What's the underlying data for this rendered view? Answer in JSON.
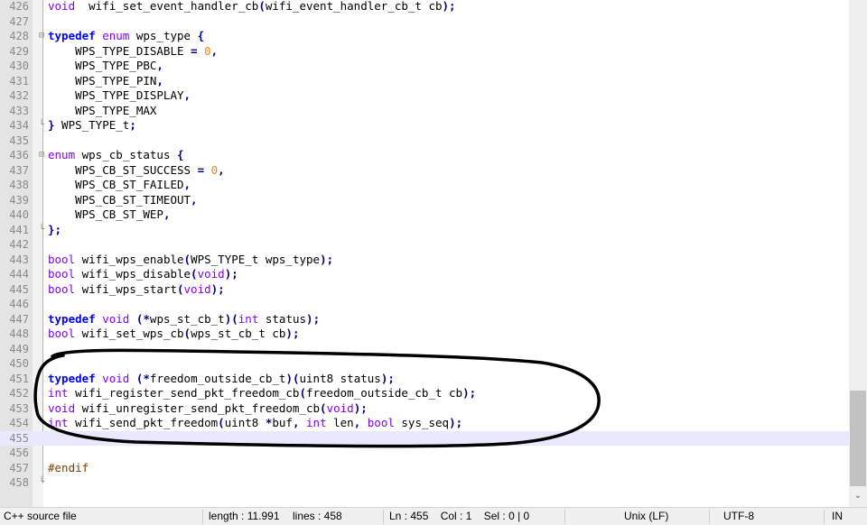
{
  "editor": {
    "current_line": "455",
    "lines": [
      {
        "n": "426",
        "tokens": [
          [
            "ty",
            "void"
          ],
          [
            "",
            "  wifi_set_event_handler_cb"
          ],
          [
            "op",
            "("
          ],
          [
            "",
            "wifi_event_handler_cb_t cb"
          ],
          [
            "op",
            ");"
          ]
        ]
      },
      {
        "n": "427",
        "tokens": []
      },
      {
        "n": "428",
        "fold": "⊟",
        "tokens": [
          [
            "kw",
            "typedef"
          ],
          [
            "",
            " "
          ],
          [
            "ty",
            "enum"
          ],
          [
            "",
            " wps_type "
          ],
          [
            "op",
            "{"
          ]
        ]
      },
      {
        "n": "429",
        "tokens": [
          [
            "",
            "    WPS_TYPE_DISABLE "
          ],
          [
            "op",
            "="
          ],
          [
            "",
            " "
          ],
          [
            "num",
            "0"
          ],
          [
            "op",
            ","
          ]
        ]
      },
      {
        "n": "430",
        "tokens": [
          [
            "",
            "    WPS_TYPE_PBC"
          ],
          [
            "op",
            ","
          ]
        ]
      },
      {
        "n": "431",
        "tokens": [
          [
            "",
            "    WPS_TYPE_PIN"
          ],
          [
            "op",
            ","
          ]
        ]
      },
      {
        "n": "432",
        "tokens": [
          [
            "",
            "    WPS_TYPE_DISPLAY"
          ],
          [
            "op",
            ","
          ]
        ]
      },
      {
        "n": "433",
        "tokens": [
          [
            "",
            "    WPS_TYPE_MAX"
          ]
        ]
      },
      {
        "n": "434",
        "fold": "└",
        "tokens": [
          [
            "op",
            "}"
          ],
          [
            "",
            " WPS_TYPE_t"
          ],
          [
            "op",
            ";"
          ]
        ]
      },
      {
        "n": "435",
        "tokens": []
      },
      {
        "n": "436",
        "fold": "⊟",
        "tokens": [
          [
            "ty",
            "enum"
          ],
          [
            "",
            " wps_cb_status "
          ],
          [
            "op",
            "{"
          ]
        ]
      },
      {
        "n": "437",
        "tokens": [
          [
            "",
            "    WPS_CB_ST_SUCCESS "
          ],
          [
            "op",
            "="
          ],
          [
            "",
            " "
          ],
          [
            "num",
            "0"
          ],
          [
            "op",
            ","
          ]
        ]
      },
      {
        "n": "438",
        "tokens": [
          [
            "",
            "    WPS_CB_ST_FAILED"
          ],
          [
            "op",
            ","
          ]
        ]
      },
      {
        "n": "439",
        "tokens": [
          [
            "",
            "    WPS_CB_ST_TIMEOUT"
          ],
          [
            "op",
            ","
          ]
        ]
      },
      {
        "n": "440",
        "tokens": [
          [
            "",
            "    WPS_CB_ST_WEP"
          ],
          [
            "op",
            ","
          ]
        ]
      },
      {
        "n": "441",
        "fold": "└",
        "tokens": [
          [
            "op",
            "};"
          ]
        ]
      },
      {
        "n": "442",
        "tokens": []
      },
      {
        "n": "443",
        "tokens": [
          [
            "ty",
            "bool"
          ],
          [
            "",
            " wifi_wps_enable"
          ],
          [
            "op",
            "("
          ],
          [
            "",
            "WPS_TYPE_t wps_type"
          ],
          [
            "op",
            ");"
          ]
        ]
      },
      {
        "n": "444",
        "tokens": [
          [
            "ty",
            "bool"
          ],
          [
            "",
            " wifi_wps_disable"
          ],
          [
            "op",
            "("
          ],
          [
            "ty",
            "void"
          ],
          [
            "op",
            ");"
          ]
        ]
      },
      {
        "n": "445",
        "tokens": [
          [
            "ty",
            "bool"
          ],
          [
            "",
            " wifi_wps_start"
          ],
          [
            "op",
            "("
          ],
          [
            "ty",
            "void"
          ],
          [
            "op",
            ");"
          ]
        ]
      },
      {
        "n": "446",
        "tokens": []
      },
      {
        "n": "447",
        "tokens": [
          [
            "kw",
            "typedef"
          ],
          [
            "",
            " "
          ],
          [
            "ty",
            "void"
          ],
          [
            "",
            " "
          ],
          [
            "op",
            "(*"
          ],
          [
            "",
            "wps_st_cb_t"
          ],
          [
            "op",
            ")("
          ],
          [
            "ty",
            "int"
          ],
          [
            "",
            " status"
          ],
          [
            "op",
            ");"
          ]
        ]
      },
      {
        "n": "448",
        "tokens": [
          [
            "ty",
            "bool"
          ],
          [
            "",
            " wifi_set_wps_cb"
          ],
          [
            "op",
            "("
          ],
          [
            "",
            "wps_st_cb_t cb"
          ],
          [
            "op",
            ");"
          ]
        ]
      },
      {
        "n": "449",
        "tokens": []
      },
      {
        "n": "450",
        "tokens": []
      },
      {
        "n": "451",
        "tokens": [
          [
            "kw",
            "typedef"
          ],
          [
            "",
            " "
          ],
          [
            "ty",
            "void"
          ],
          [
            "",
            " "
          ],
          [
            "op",
            "(*"
          ],
          [
            "",
            "freedom_outside_cb_t"
          ],
          [
            "op",
            ")("
          ],
          [
            "",
            "uint8 status"
          ],
          [
            "op",
            ");"
          ]
        ]
      },
      {
        "n": "452",
        "tokens": [
          [
            "ty",
            "int"
          ],
          [
            "",
            " wifi_register_send_pkt_freedom_cb"
          ],
          [
            "op",
            "("
          ],
          [
            "",
            "freedom_outside_cb_t cb"
          ],
          [
            "op",
            ");"
          ]
        ]
      },
      {
        "n": "453",
        "tokens": [
          [
            "ty",
            "void"
          ],
          [
            "",
            " wifi_unregister_send_pkt_freedom_cb"
          ],
          [
            "op",
            "("
          ],
          [
            "ty",
            "void"
          ],
          [
            "op",
            ");"
          ]
        ]
      },
      {
        "n": "454",
        "tokens": [
          [
            "ty",
            "int"
          ],
          [
            "",
            " wifi_send_pkt_freedom"
          ],
          [
            "op",
            "("
          ],
          [
            "",
            "uint8 "
          ],
          [
            "op",
            "*"
          ],
          [
            "",
            "buf"
          ],
          [
            "op",
            ","
          ],
          [
            "",
            " "
          ],
          [
            "ty",
            "int"
          ],
          [
            "",
            " len"
          ],
          [
            "op",
            ","
          ],
          [
            "",
            " "
          ],
          [
            "ty",
            "bool"
          ],
          [
            "",
            " sys_seq"
          ],
          [
            "op",
            ");"
          ]
        ]
      },
      {
        "n": "455",
        "tokens": []
      },
      {
        "n": "456",
        "tokens": []
      },
      {
        "n": "457",
        "tokens": [
          [
            "pp",
            "#endif"
          ]
        ]
      },
      {
        "n": "458",
        "fold": "└",
        "tokens": []
      }
    ]
  },
  "statusbar": {
    "file_type": "C++ source file",
    "length": "length : 11.991",
    "lines": "lines : 458",
    "position": "Ln : 455    Col : 1    Sel : 0 | 0",
    "eol": "Unix (LF)",
    "encoding": "UTF-8",
    "mode": "IN"
  },
  "colors": {
    "keyword": "#0000ff",
    "type": "#8000ff",
    "number": "#ff8000",
    "operator": "#000080",
    "preprocessor": "#804000",
    "current_line_bg": "#e8e8ff",
    "annotation_ink": "#000000"
  },
  "icons": {
    "scroll_down": "chevron-down-icon",
    "fold_open": "fold-open-icon",
    "fold_end": "fold-end-icon"
  },
  "scrollbar": {
    "down_glyph": "⌄"
  }
}
